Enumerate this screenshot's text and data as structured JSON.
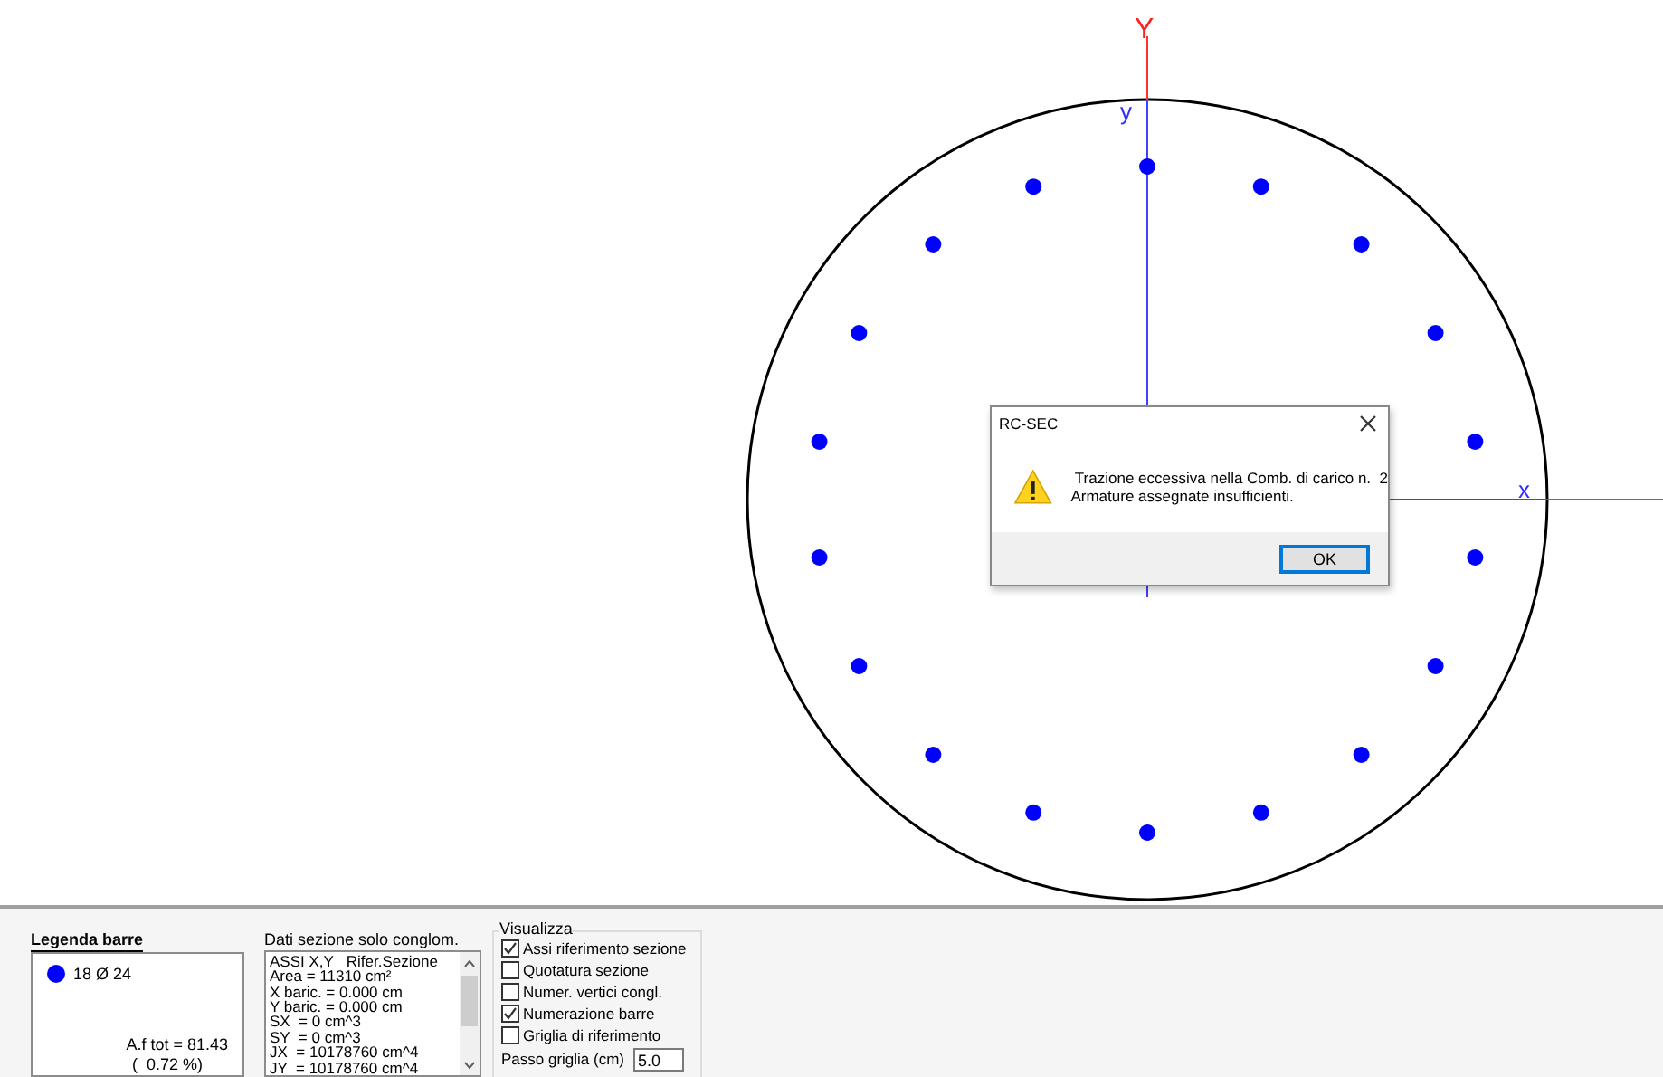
{
  "axes": {
    "global_y_label": "Y",
    "section_y_label": "y",
    "section_x_label": "x"
  },
  "dialog": {
    "title": "RC-SEC",
    "message_lines": [
      " Trazione eccessiva nella Comb. di carico n.  2",
      "Armature assegnate insufficienti."
    ],
    "button": "OK"
  },
  "legend": {
    "title": "Legenda barre",
    "items": [
      {
        "label": "18 Ø 24",
        "color": "#0000ff"
      }
    ],
    "total": "A.f tot = 81.43",
    "percent": "(  0.72 %)"
  },
  "section_data": {
    "title": "Dati sezione solo conglom.",
    "lines": [
      "ASSI X,Y   Rifer.Sezione",
      "Area = 11310 cm²",
      "X baric. = 0.000 cm",
      "Y baric. = 0.000 cm",
      "SX  = 0 cm^3",
      "SY  = 0 cm^3",
      "JX  = 10178760 cm^4",
      "JY  = 10178760 cm^4"
    ]
  },
  "display": {
    "title": "Visualizza",
    "checkboxes": [
      {
        "label": "Assi riferimento sezione",
        "checked": true
      },
      {
        "label": "Quotatura sezione",
        "checked": false
      },
      {
        "label": "Numer. vertici congl.",
        "checked": false
      },
      {
        "label": "Numerazione barre",
        "checked": true
      },
      {
        "label": "Griglia di riferimento",
        "checked": false
      }
    ],
    "grid_step": {
      "label": "Passo griglia (cm)",
      "value": "5.0"
    }
  }
}
